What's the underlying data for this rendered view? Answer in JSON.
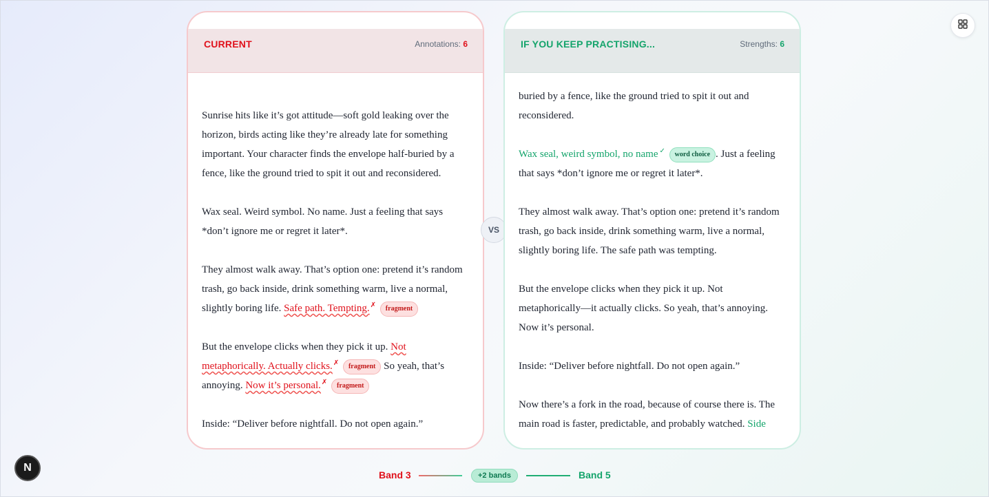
{
  "current": {
    "title": "CURRENT",
    "counter_label": "Annotations:",
    "counter_value": "6",
    "p1": "Sunrise hits like it’s got attitude—soft gold leaking over the horizon, birds acting like they’re already late for something important. Your character finds the envelope half-buried by a fence, like the ground tried to spit it out and reconsidered.",
    "p2": "Wax seal. Weird symbol. No name. Just a feeling that says *don’t ignore me or regret it later*.",
    "p3_text": "They almost walk away. That’s option one: pretend it’s random trash, go back inside, drink something warm, live a normal, slightly boring life. ",
    "p3_err": "Safe path. Tempting.",
    "p4_a": "But the envelope clicks when they pick it up. ",
    "p4_err1": "Not metaphorically. Actually clicks.",
    "p4_b": " So yeah, that’s annoying. ",
    "p4_err2": "Now it’s personal.",
    "p5": "Inside: “Deliver before nightfall. Do not open again.”",
    "mark": "✗",
    "tag_fragment": "fragment"
  },
  "future": {
    "title": "IF YOU KEEP PRACTISING...",
    "counter_label": "Strengths:",
    "counter_value": "6",
    "p1": "buried by a fence, like the ground tried to spit it out and reconsidered.",
    "p2_good": "Wax seal, weird symbol, no name",
    "p2_tag": "word choice",
    "p2_rest": ". Just a feeling that says *don’t ignore me or regret it later*.",
    "p3": "They almost walk away. That’s option one: pretend it’s random trash, go back inside, drink something warm, live a normal, slightly boring life. The safe path was tempting.",
    "p4": "But the envelope clicks when they pick it up. Not metaphorically—it actually clicks. So yeah, that’s annoying. Now it’s personal.",
    "p5": "Inside: “Deliver before nightfall. Do not open again.”",
    "p6_text": "Now there’s a fork in the road, because of course there is. The main road is faster, predictable, and probably watched. ",
    "p6_good": "Side",
    "mark": "✓"
  },
  "vs_label": "VS",
  "bands": {
    "from": "Band 3",
    "delta": "+2 bands",
    "to": "Band 5"
  },
  "badge_letter": "N",
  "icons": {
    "layout": "grid-layout-icon"
  },
  "colors": {
    "error": "#e0111b",
    "success": "#14a46b"
  }
}
